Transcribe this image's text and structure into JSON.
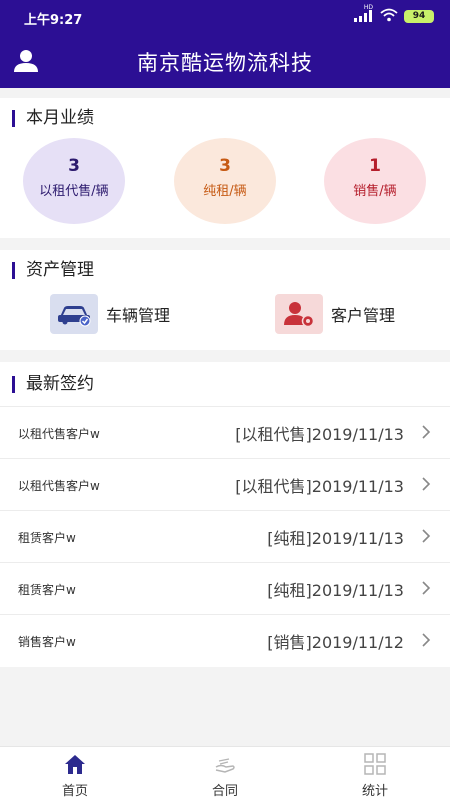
{
  "status_bar": {
    "time": "上午9:27",
    "network": "HD",
    "battery": "94"
  },
  "header": {
    "title": "南京酷运物流科技",
    "user_icon": "user-icon"
  },
  "performance": {
    "title": "本月业绩",
    "items": [
      {
        "count": "3",
        "label": "以租代售/辆",
        "color": "#2c1a6e"
      },
      {
        "count": "3",
        "label": "纯租/辆",
        "color": "#c65a14"
      },
      {
        "count": "1",
        "label": "销售/辆",
        "color": "#b51e2c"
      }
    ]
  },
  "assets": {
    "title": "资产管理",
    "items": [
      {
        "label": "车辆管理",
        "icon": "car-check-icon"
      },
      {
        "label": "客户管理",
        "icon": "user-settings-icon"
      }
    ]
  },
  "latest": {
    "title": "最新签约",
    "rows": [
      {
        "name": "以租代售客户w",
        "value": "[以租代售]2019/11/13"
      },
      {
        "name": "以租代售客户w",
        "value": "[以租代售]2019/11/13"
      },
      {
        "name": "租赁客户w",
        "value": "[纯租]2019/11/13"
      },
      {
        "name": "租赁客户w",
        "value": "[纯租]2019/11/13"
      },
      {
        "name": "销售客户w",
        "value": "[销售]2019/11/12"
      }
    ]
  },
  "nav": {
    "items": [
      {
        "label": "首页",
        "icon": "home-icon",
        "active": true
      },
      {
        "label": "合同",
        "icon": "contract-icon",
        "active": false
      },
      {
        "label": "统计",
        "icon": "stats-grid-icon",
        "active": false
      }
    ]
  },
  "colors": {
    "primary": "#2c0f94",
    "background": "#f3f3f3"
  }
}
